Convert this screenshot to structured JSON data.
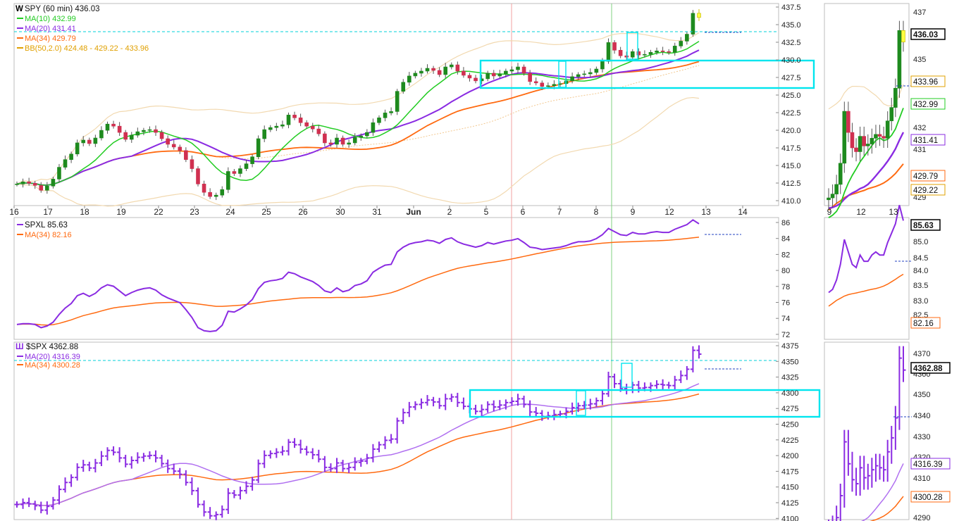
{
  "chart_data": [
    {
      "type": "candlestick",
      "panel": "spy",
      "title": "SPY (60 min) 436.03",
      "last": "436.03",
      "ylim": [
        409,
        438
      ],
      "y_ticks": [
        "437.5",
        "435.0",
        "432.5",
        "430.0",
        "427.5",
        "425.0",
        "422.5",
        "420.0",
        "417.5",
        "415.0",
        "412.5",
        "410.0"
      ],
      "x_ticks": [
        "16",
        "17",
        "18",
        "19",
        "22",
        "23",
        "24",
        "25",
        "26",
        "30",
        "31",
        "Jun",
        "2",
        "5",
        "6",
        "7",
        "8",
        "9",
        "12",
        "13",
        "14"
      ],
      "legend": [
        {
          "label": "MA(10) 432.99",
          "color": "#22cc22"
        },
        {
          "label": "MA(20) 431.41",
          "color": "#8a2be2"
        },
        {
          "label": "MA(34) 429.79",
          "color": "#ff6a10"
        },
        {
          "label": "BB(50,2.0) 424.48 - 429.22 - 433.96",
          "color": "#e0a000"
        }
      ],
      "price_badges": [
        {
          "value": "436.03",
          "color": "#000000"
        },
        {
          "value": "433.96",
          "color": "#e0a000"
        },
        {
          "value": "432.99",
          "color": "#22cc22"
        },
        {
          "value": "431.41",
          "color": "#8a2be2"
        },
        {
          "value": "429.79",
          "color": "#ff6a10"
        },
        {
          "value": "429.22",
          "color": "#e0a000"
        }
      ],
      "zoom_y_ticks": [
        "437",
        "435",
        "433",
        "432",
        "431",
        "430",
        "429"
      ],
      "zoom_x_ticks": [
        "9",
        "12",
        "13"
      ],
      "closes": [
        412.1,
        412.4,
        412.2,
        411.9,
        411.2,
        411.8,
        412.8,
        414.5,
        415.6,
        416.4,
        418.0,
        418.4,
        417.9,
        418.7,
        419.8,
        420.7,
        420.4,
        419.5,
        418.5,
        419.1,
        419.6,
        419.8,
        419.9,
        419.5,
        418.6,
        417.8,
        417.4,
        416.9,
        415.6,
        414.3,
        412.1,
        410.9,
        410.3,
        410.5,
        411.3,
        413.9,
        413.6,
        414.3,
        415.0,
        416.0,
        418.6,
        419.9,
        420.2,
        420.4,
        420.6,
        422.0,
        421.6,
        420.9,
        420.4,
        420.0,
        419.3,
        418.0,
        417.8,
        418.7,
        417.8,
        418.0,
        418.8,
        419.0,
        419.5,
        420.9,
        421.6,
        422.3,
        422.5,
        425.4,
        426.7,
        427.6,
        428.0,
        428.3,
        428.7,
        428.4,
        427.8,
        428.9,
        429.2,
        428.3,
        427.7,
        427.3,
        426.9,
        427.2,
        428.0,
        427.6,
        427.9,
        428.3,
        428.5,
        428.9,
        428.0,
        426.8,
        426.6,
        426.1,
        426.2,
        426.4,
        426.5,
        426.9,
        427.5,
        427.8,
        427.9,
        428.1,
        428.6,
        429.7,
        432.4,
        431.3,
        430.5,
        430.3,
        431.1,
        430.6,
        430.7,
        431.0,
        431.2,
        431.1,
        431.0,
        431.9,
        432.6,
        433.6,
        436.6,
        436.0
      ]
    },
    {
      "type": "line",
      "panel": "spxl",
      "title": "SPXL 85.63",
      "ylim": [
        71,
        86.6
      ],
      "y_ticks": [
        "86",
        "84",
        "82",
        "80",
        "78",
        "76",
        "74",
        "72"
      ],
      "legend": [
        {
          "label": "SPXL 85.63",
          "color": "#8a2be2"
        },
        {
          "label": "MA(34) 82.16",
          "color": "#ff6a10"
        }
      ],
      "price_badges": [
        {
          "value": "85.63",
          "color": "#000000"
        },
        {
          "value": "82.16",
          "color": "#ff6a10"
        }
      ],
      "zoom_y_ticks": [
        "85.5",
        "85.0",
        "84.5",
        "84.0",
        "83.5",
        "83.0",
        "82.5"
      ],
      "closes": [
        72.9,
        73.0,
        73.0,
        72.9,
        72.5,
        72.7,
        73.2,
        74.2,
        75.0,
        75.6,
        76.6,
        76.9,
        76.5,
        76.9,
        77.6,
        78.0,
        77.8,
        77.2,
        76.6,
        77.0,
        77.3,
        77.5,
        77.6,
        77.3,
        76.7,
        76.3,
        76.0,
        75.7,
        74.8,
        73.8,
        72.5,
        72.1,
        72.0,
        72.1,
        72.8,
        74.6,
        74.5,
        74.9,
        75.4,
        76.1,
        77.5,
        78.3,
        78.5,
        78.6,
        78.8,
        79.6,
        79.4,
        79.0,
        78.7,
        78.4,
        77.9,
        77.2,
        77.0,
        77.6,
        77.1,
        77.3,
        77.9,
        78.1,
        78.5,
        79.6,
        80.1,
        80.5,
        80.6,
        82.2,
        82.8,
        83.2,
        83.4,
        83.5,
        83.7,
        83.6,
        83.3,
        83.8,
        84.0,
        83.5,
        83.2,
        83.0,
        82.8,
        83.0,
        83.4,
        83.2,
        83.4,
        83.6,
        83.7,
        83.9,
        83.4,
        82.8,
        82.7,
        82.5,
        82.6,
        82.7,
        82.8,
        83.0,
        83.3,
        83.5,
        83.5,
        83.6,
        83.9,
        84.4,
        85.2,
        84.8,
        84.4,
        84.3,
        84.7,
        84.5,
        84.5,
        84.7,
        84.8,
        84.7,
        84.7,
        85.1,
        85.4,
        85.7,
        86.3,
        85.8
      ]
    },
    {
      "type": "ohlc",
      "panel": "spx",
      "title": "$SPX 4362.88",
      "ylim": [
        4098,
        4380
      ],
      "y_ticks": [
        "4375",
        "4350",
        "4325",
        "4300",
        "4275",
        "4250",
        "4225",
        "4200",
        "4175",
        "4150",
        "4125",
        "4100"
      ],
      "legend": [
        {
          "label": "MA(20) 4316.39",
          "color": "#8a2be2"
        },
        {
          "label": "MA(34) 4300.28",
          "color": "#ff6a10"
        }
      ],
      "price_badges": [
        {
          "value": "4362.88",
          "color": "#000000"
        },
        {
          "value": "4316.39",
          "color": "#8a2be2"
        },
        {
          "value": "4300.28",
          "color": "#ff6a10"
        }
      ],
      "zoom_y_ticks": [
        "4370",
        "4360",
        "4350",
        "4340",
        "4330",
        "4320",
        "4310",
        "4300",
        "4290"
      ],
      "closes": [
        4122,
        4125,
        4123,
        4120,
        4113,
        4119,
        4129,
        4146,
        4157,
        4165,
        4181,
        4185,
        4180,
        4188,
        4199,
        4208,
        4205,
        4196,
        4186,
        4192,
        4197,
        4199,
        4200,
        4196,
        4187,
        4179,
        4175,
        4170,
        4157,
        4144,
        4122,
        4110,
        4104,
        4106,
        4114,
        4140,
        4137,
        4144,
        4151,
        4161,
        4187,
        4200,
        4203,
        4205,
        4207,
        4221,
        4217,
        4210,
        4205,
        4201,
        4194,
        4181,
        4179,
        4188,
        4179,
        4181,
        4189,
        4191,
        4196,
        4210,
        4217,
        4224,
        4226,
        4255,
        4268,
        4277,
        4281,
        4284,
        4288,
        4285,
        4279,
        4290,
        4293,
        4284,
        4278,
        4274,
        4270,
        4273,
        4281,
        4277,
        4280,
        4284,
        4286,
        4290,
        4281,
        4269,
        4267,
        4262,
        4263,
        4265,
        4266,
        4270,
        4276,
        4279,
        4280,
        4282,
        4287,
        4298,
        4325,
        4314,
        4306,
        4304,
        4312,
        4307,
        4308,
        4311,
        4313,
        4312,
        4311,
        4320,
        4327,
        4337,
        4367,
        4361
      ]
    }
  ]
}
